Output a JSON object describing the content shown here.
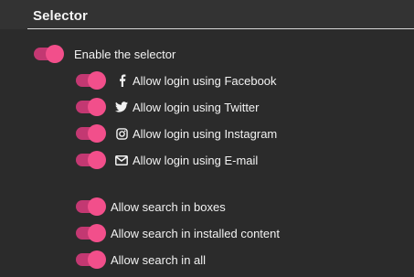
{
  "panel": {
    "title": "Selector"
  },
  "colors": {
    "background": "#2b2b2b",
    "header": "#333333",
    "toggle_track": "#c33872",
    "toggle_knob": "#f24f8b",
    "text": "#f2f2f2"
  },
  "settings": {
    "enable_selector": {
      "label": "Enable the selector",
      "enabled": true
    },
    "login_facebook": {
      "label": "Allow login using Facebook",
      "icon": "facebook-icon",
      "enabled": true
    },
    "login_twitter": {
      "label": "Allow login using Twitter",
      "icon": "twitter-icon",
      "enabled": true
    },
    "login_instagram": {
      "label": "Allow login using Instagram",
      "icon": "instagram-icon",
      "enabled": true
    },
    "login_email": {
      "label": "Allow login using E-mail",
      "icon": "envelope-icon",
      "enabled": true
    },
    "search_boxes": {
      "label": "Allow search in boxes",
      "enabled": true
    },
    "search_installed": {
      "label": "Allow search in installed content",
      "enabled": true
    },
    "search_all": {
      "label": "Allow search in all",
      "enabled": true
    }
  }
}
